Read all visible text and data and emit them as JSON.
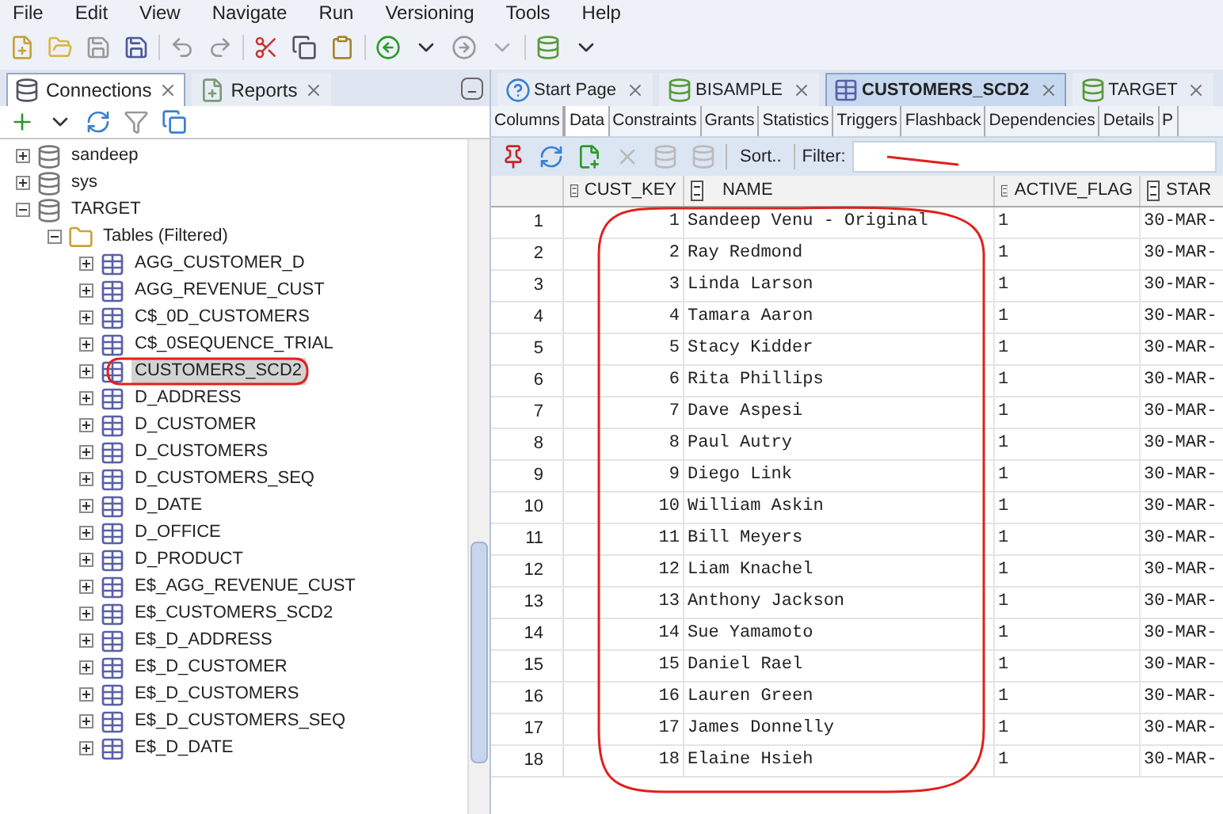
{
  "menu": [
    "File",
    "Edit",
    "View",
    "Navigate",
    "Run",
    "Versioning",
    "Tools",
    "Help"
  ],
  "left_panel": {
    "tabs": [
      {
        "label": "Connections",
        "selected": true
      },
      {
        "label": "Reports",
        "selected": false
      }
    ],
    "tree": [
      {
        "label": "sandeep",
        "kind": "connection",
        "expanded": false,
        "selected": false
      },
      {
        "label": "sys",
        "kind": "connection",
        "expanded": false,
        "selected": false
      },
      {
        "label": "TARGET",
        "kind": "connection",
        "expanded": true,
        "selected": false,
        "children": [
          {
            "label": "Tables (Filtered)",
            "kind": "folder",
            "expanded": true,
            "selected": false,
            "children": [
              {
                "label": "AGG_CUSTOMER_D",
                "kind": "table",
                "expanded": false,
                "selected": false
              },
              {
                "label": "AGG_REVENUE_CUST",
                "kind": "table",
                "expanded": false,
                "selected": false
              },
              {
                "label": "C$_0D_CUSTOMERS",
                "kind": "table",
                "expanded": false,
                "selected": false
              },
              {
                "label": "C$_0SEQUENCE_TRIAL",
                "kind": "table",
                "expanded": false,
                "selected": false
              },
              {
                "label": "CUSTOMERS_SCD2",
                "kind": "table",
                "expanded": false,
                "selected": true
              },
              {
                "label": "D_ADDRESS",
                "kind": "table",
                "expanded": false,
                "selected": false
              },
              {
                "label": "D_CUSTOMER",
                "kind": "table",
                "expanded": false,
                "selected": false
              },
              {
                "label": "D_CUSTOMERS",
                "kind": "table",
                "expanded": false,
                "selected": false
              },
              {
                "label": "D_CUSTOMERS_SEQ",
                "kind": "table",
                "expanded": false,
                "selected": false
              },
              {
                "label": "D_DATE",
                "kind": "table",
                "expanded": false,
                "selected": false
              },
              {
                "label": "D_OFFICE",
                "kind": "table",
                "expanded": false,
                "selected": false
              },
              {
                "label": "D_PRODUCT",
                "kind": "table",
                "expanded": false,
                "selected": false
              },
              {
                "label": "E$_AGG_REVENUE_CUST",
                "kind": "table",
                "expanded": false,
                "selected": false
              },
              {
                "label": "E$_CUSTOMERS_SCD2",
                "kind": "table",
                "expanded": false,
                "selected": false
              },
              {
                "label": "E$_D_ADDRESS",
                "kind": "table",
                "expanded": false,
                "selected": false
              },
              {
                "label": "E$_D_CUSTOMER",
                "kind": "table",
                "expanded": false,
                "selected": false
              },
              {
                "label": "E$_D_CUSTOMERS",
                "kind": "table",
                "expanded": false,
                "selected": false
              },
              {
                "label": "E$_D_CUSTOMERS_SEQ",
                "kind": "table",
                "expanded": false,
                "selected": false
              },
              {
                "label": "E$_D_DATE",
                "kind": "table",
                "expanded": false,
                "selected": false
              }
            ]
          }
        ]
      }
    ]
  },
  "editor": {
    "tabs": [
      {
        "label": "Start Page",
        "kind": "help",
        "selected": false
      },
      {
        "label": "BISAMPLE",
        "kind": "sql",
        "selected": false
      },
      {
        "label": "CUSTOMERS_SCD2",
        "kind": "table",
        "selected": true
      },
      {
        "label": "TARGET",
        "kind": "sql",
        "selected": false
      }
    ],
    "subtabs": [
      {
        "label": "Columns",
        "selected": false
      },
      {
        "label": "Data",
        "selected": true
      },
      {
        "label": "Constraints",
        "selected": false
      },
      {
        "label": "Grants",
        "selected": false
      },
      {
        "label": "Statistics",
        "selected": false
      },
      {
        "label": "Triggers",
        "selected": false
      },
      {
        "label": "Flashback",
        "selected": false
      },
      {
        "label": "Dependencies",
        "selected": false
      },
      {
        "label": "Details",
        "selected": false
      },
      {
        "label": "P",
        "selected": false
      }
    ],
    "sort_label": "Sort..",
    "filter_label": "Filter:",
    "table": {
      "columns": [
        "",
        "CUST_KEY",
        "NAME",
        "ACTIVE_FLAG",
        "STAR"
      ],
      "rows": [
        [
          "1",
          "1",
          "Sandeep Venu - Original",
          "1",
          "30-MAR-"
        ],
        [
          "2",
          "2",
          "Ray Redmond",
          "1",
          "30-MAR-"
        ],
        [
          "3",
          "3",
          "Linda Larson",
          "1",
          "30-MAR-"
        ],
        [
          "4",
          "4",
          "Tamara Aaron",
          "1",
          "30-MAR-"
        ],
        [
          "5",
          "5",
          "Stacy Kidder",
          "1",
          "30-MAR-"
        ],
        [
          "6",
          "6",
          "Rita Phillips",
          "1",
          "30-MAR-"
        ],
        [
          "7",
          "7",
          "Dave Aspesi",
          "1",
          "30-MAR-"
        ],
        [
          "8",
          "8",
          "Paul Autry",
          "1",
          "30-MAR-"
        ],
        [
          "9",
          "9",
          "Diego Link",
          "1",
          "30-MAR-"
        ],
        [
          "10",
          "10",
          "William Askin",
          "1",
          "30-MAR-"
        ],
        [
          "11",
          "11",
          "Bill Meyers",
          "1",
          "30-MAR-"
        ],
        [
          "12",
          "12",
          "Liam Knachel",
          "1",
          "30-MAR-"
        ],
        [
          "13",
          "13",
          "Anthony Jackson",
          "1",
          "30-MAR-"
        ],
        [
          "14",
          "14",
          "Sue Yamamoto",
          "1",
          "30-MAR-"
        ],
        [
          "15",
          "15",
          "Daniel Rael",
          "1",
          "30-MAR-"
        ],
        [
          "16",
          "16",
          "Lauren Green",
          "1",
          "30-MAR-"
        ],
        [
          "17",
          "17",
          "James Donnelly",
          "1",
          "30-MAR-"
        ],
        [
          "18",
          "18",
          "Elaine Hsieh",
          "1",
          "30-MAR-"
        ]
      ]
    }
  }
}
